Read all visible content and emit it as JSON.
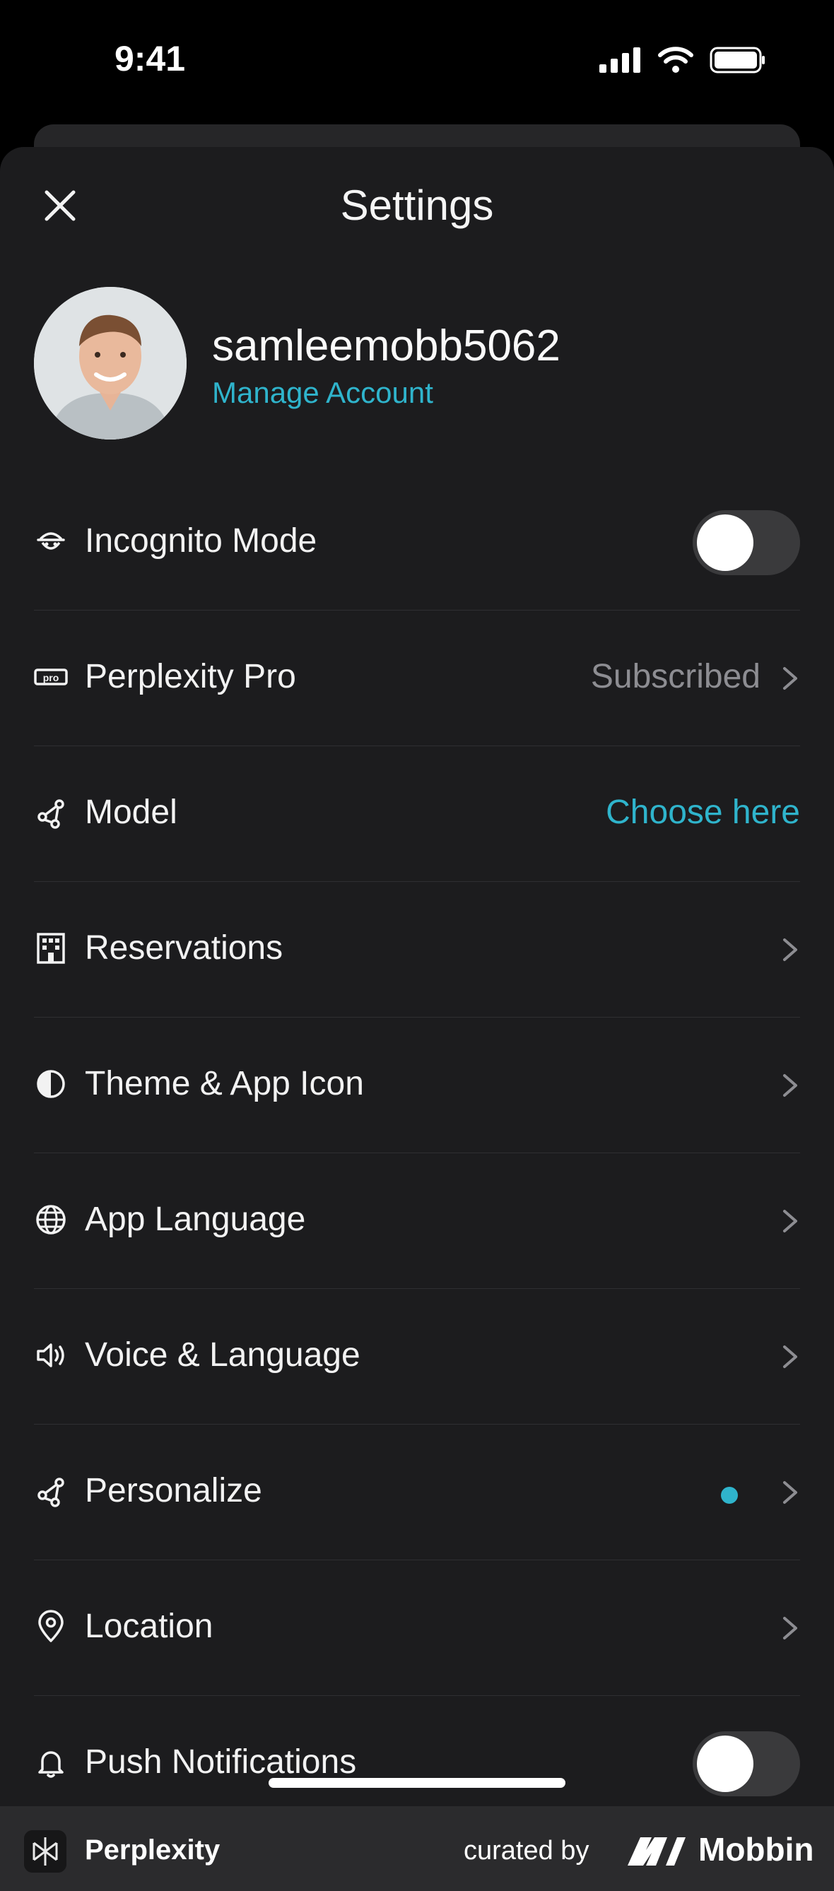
{
  "status_bar": {
    "time": "9:41"
  },
  "header": {
    "title": "Settings",
    "close_icon": "close-icon"
  },
  "profile": {
    "username": "samleemobb5062",
    "manage_account": "Manage Account"
  },
  "rows": [
    {
      "icon": "incognito-icon",
      "label": "Incognito Mode",
      "control": "toggle",
      "enabled": false
    },
    {
      "icon": "pro-badge-icon",
      "label": "Perplexity Pro",
      "value": "Subscribed",
      "control": "chevron"
    },
    {
      "icon": "model-icon",
      "label": "Model",
      "value": "Choose here",
      "control": "link"
    },
    {
      "icon": "building-icon",
      "label": "Reservations",
      "control": "chevron"
    },
    {
      "icon": "theme-icon",
      "label": "Theme & App Icon",
      "control": "chevron"
    },
    {
      "icon": "globe-icon",
      "label": "App Language",
      "control": "chevron"
    },
    {
      "icon": "speaker-icon",
      "label": "Voice & Language",
      "control": "chevron"
    },
    {
      "icon": "personalize-icon",
      "label": "Personalize",
      "control": "chevron",
      "badge": "dot"
    },
    {
      "icon": "location-pin-icon",
      "label": "Location",
      "control": "chevron"
    },
    {
      "icon": "bell-icon",
      "label": "Push Notifications",
      "control": "toggle",
      "enabled": false
    }
  ],
  "footer": {
    "brand": "Perplexity",
    "curated_by": "curated by",
    "mobbin": "Mobbin"
  },
  "colors": {
    "accent": "#2fb4cc",
    "sheet": "#1c1c1e",
    "divider": "#2f2f32"
  }
}
